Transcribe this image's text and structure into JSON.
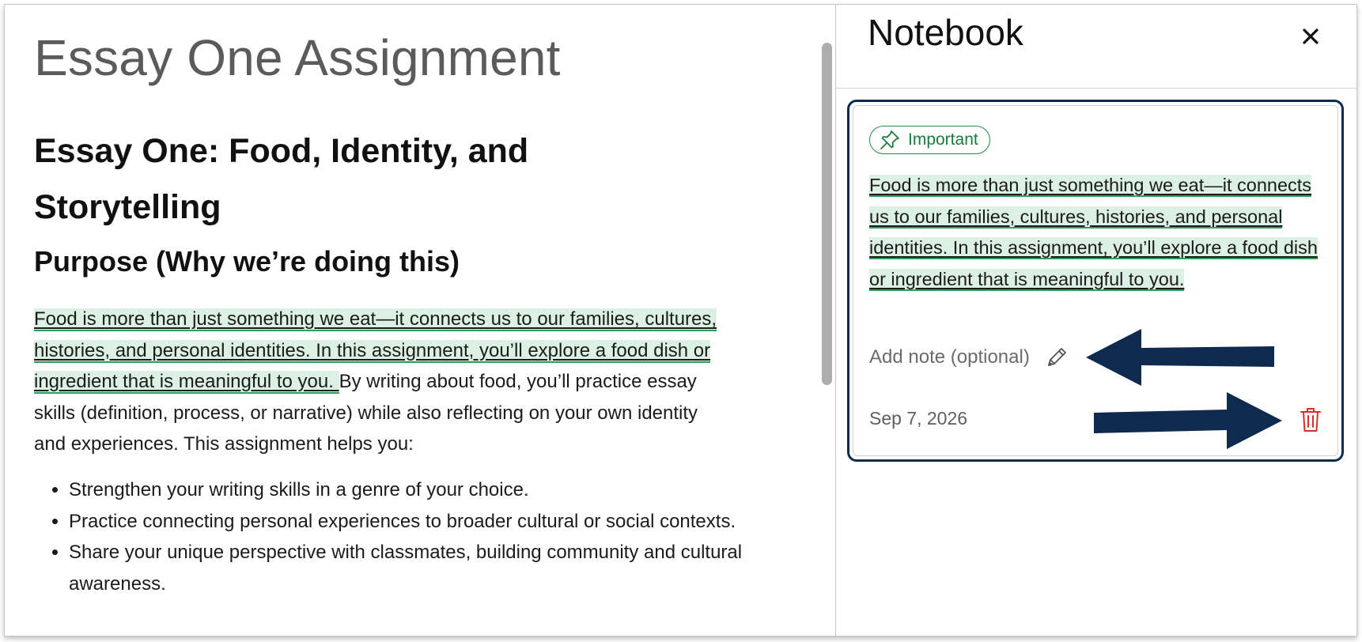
{
  "content": {
    "assignment_title": "Essay One Assignment",
    "essay_heading": "Essay One: Food, Identity, and Storytelling",
    "purpose_heading": "Purpose (Why we’re doing this)",
    "intro_highlighted": "Food is more than just something we eat—it connects us to our families, cultures, histories, and personal identities. In this assignment, you’ll explore a food dish or ingredient that is meaningful to you. ",
    "intro_rest": "By writing about food, you’ll practice essay skills (definition, process, or narrative) while also reflecting on your own identity and experiences. This assignment helps you:",
    "list_items": [
      "Strengthen your writing skills in a genre of your choice.",
      "Practice connecting personal experiences to broader cultural or social contexts.",
      "Share your unique perspective with classmates, building community and cultural awareness."
    ]
  },
  "notebook": {
    "title": "Notebook",
    "close_icon": "close-icon",
    "note": {
      "badge_label": "Important",
      "badge_icon": "pin-icon",
      "quote": "Food is more than just something we eat—it connects us to our families, cultures, histories, and personal identities. In this assignment, you’ll explore a food dish or ingredient that is meaningful to you.",
      "add_note_placeholder": "Add note (optional)",
      "edit_icon": "pencil-icon",
      "date": "Sep 7, 2026",
      "delete_icon": "trash-icon"
    }
  },
  "colors": {
    "highlight_bg": "#dcf1e3",
    "highlight_underline": "#2e9e5a",
    "badge_green": "#1e7a3c",
    "card_border": "#0e2b4e",
    "arrow": "#0e2b4e",
    "delete_red": "#d0312d"
  }
}
